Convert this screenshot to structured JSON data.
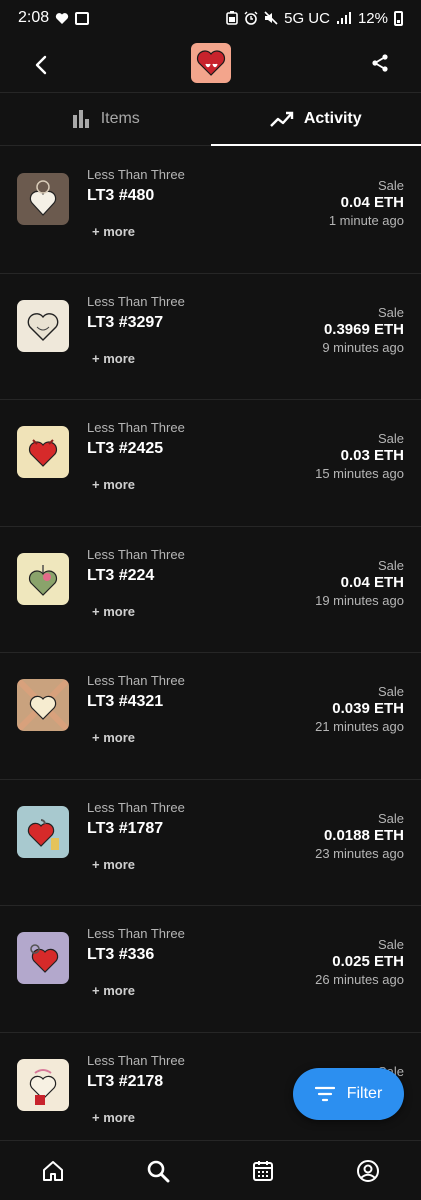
{
  "status_bar": {
    "time": "2:08",
    "network": "5G UC",
    "battery": "12%"
  },
  "header": {
    "logo_icon": "heart-logo-icon"
  },
  "tabs": [
    {
      "label": "Items",
      "icon": "bar-chart-icon",
      "active": false
    },
    {
      "label": "Activity",
      "icon": "trend-line-icon",
      "active": true
    }
  ],
  "rows": [
    {
      "collection": "Less Than Three",
      "name": "LT3 #480",
      "more": "+ more",
      "event": "Sale",
      "price": "0.04 ETH",
      "time": "1 minute ago",
      "bg": "#6b5a4e"
    },
    {
      "collection": "Less Than Three",
      "name": "LT3 #3297",
      "more": "+ more",
      "event": "Sale",
      "price": "0.3969 ETH",
      "time": "9 minutes ago",
      "bg": "#efe8da"
    },
    {
      "collection": "Less Than Three",
      "name": "LT3 #2425",
      "more": "+ more",
      "event": "Sale",
      "price": "0.03 ETH",
      "time": "15 minutes ago",
      "bg": "#f0e3b8"
    },
    {
      "collection": "Less Than Three",
      "name": "LT3 #224",
      "more": "+ more",
      "event": "Sale",
      "price": "0.04 ETH",
      "time": "19 minutes ago",
      "bg": "#efe7bd"
    },
    {
      "collection": "Less Than Three",
      "name": "LT3 #4321",
      "more": "+ more",
      "event": "Sale",
      "price": "0.039 ETH",
      "time": "21 minutes ago",
      "bg": "#c9a27e"
    },
    {
      "collection": "Less Than Three",
      "name": "LT3 #1787",
      "more": "+ more",
      "event": "Sale",
      "price": "0.0188 ETH",
      "time": "23 minutes ago",
      "bg": "#a8c9cf"
    },
    {
      "collection": "Less Than Three",
      "name": "LT3 #336",
      "more": "+ more",
      "event": "Sale",
      "price": "0.025 ETH",
      "time": "26 minutes ago",
      "bg": "#b3a8cc"
    },
    {
      "collection": "Less Than Three",
      "name": "LT3 #2178",
      "more": "+ more",
      "event": "Sale",
      "price": "",
      "time": "",
      "bg": "#f3ead8"
    }
  ],
  "filter_button": {
    "label": "Filter"
  },
  "bottom_nav": [
    "home-icon",
    "search-icon",
    "calendar-icon",
    "profile-icon"
  ],
  "colors": {
    "background": "#121212",
    "accent": "#2c8ff0"
  }
}
